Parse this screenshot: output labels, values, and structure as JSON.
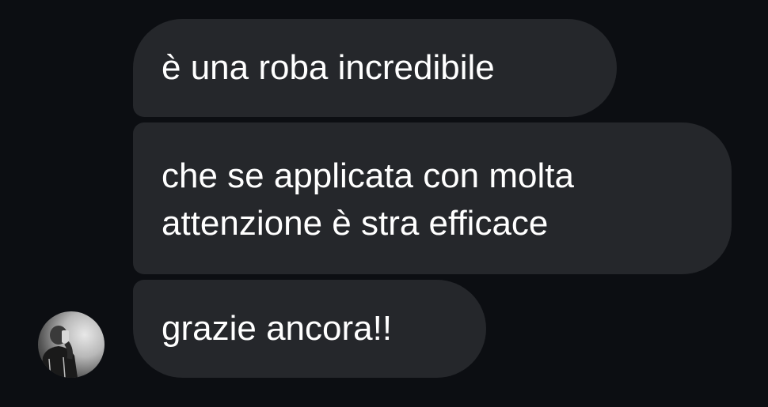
{
  "messages": [
    {
      "lines": [
        "è una roba incredibile"
      ]
    },
    {
      "lines": [
        "che se applicata con molta",
        "attenzione è stra efficace"
      ]
    },
    {
      "lines": [
        "grazie ancora!!"
      ]
    }
  ],
  "sender": {
    "avatar_icon": "user-photo-avatar"
  },
  "colors": {
    "background": "#0c0e12",
    "bubble": "#25272b",
    "text": "#ffffff"
  }
}
